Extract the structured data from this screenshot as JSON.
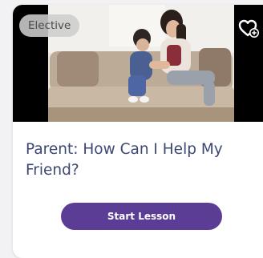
{
  "card": {
    "badge_label": "Elective",
    "title": "Parent: How Can I Help My Friend?",
    "start_button_label": "Start Lesson",
    "favorite_icon": "heart-plus-icon",
    "image_subject": "mother-comforting-child-on-sofa"
  },
  "colors": {
    "accent": "#5b3d96",
    "title_text": "#3d4773",
    "badge_bg": "#cdcdcd",
    "page_bg": "#f2f2f5"
  }
}
